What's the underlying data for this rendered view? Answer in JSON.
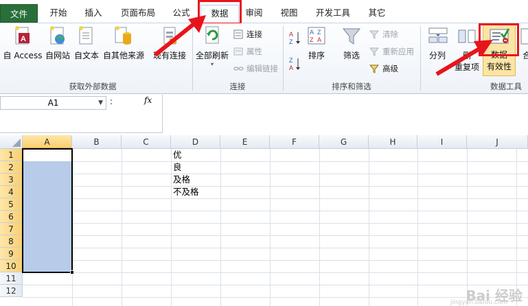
{
  "tabs": [
    {
      "label": "文件"
    },
    {
      "label": "开始"
    },
    {
      "label": "插入"
    },
    {
      "label": "页面布局"
    },
    {
      "label": "公式"
    },
    {
      "label": "数据"
    },
    {
      "label": "审阅"
    },
    {
      "label": "视图"
    },
    {
      "label": "开发工具"
    },
    {
      "label": "其它"
    }
  ],
  "ribbon": {
    "external_data": {
      "label": "获取外部数据",
      "access": "自 Access",
      "web": "自网站",
      "text": "自文本",
      "other": "自其他来源",
      "existing": "现有连接"
    },
    "connections": {
      "label": "连接",
      "refresh_all": "全部刷新",
      "connections": "连接",
      "properties": "属性",
      "edit_links": "编辑链接"
    },
    "sort_filter": {
      "label": "排序和筛选",
      "sort": "排序",
      "filter": "筛选",
      "clear": "清除",
      "reapply": "重新应用",
      "advanced": "高级"
    },
    "data_tools": {
      "label": "数据工具",
      "text_to_columns": "分列",
      "remove_dup_top": "删",
      "remove_dup_bottom": "重复项",
      "validation_top": "数据",
      "validation_bottom": "有效性",
      "consolidate": "合"
    }
  },
  "formula_bar": {
    "name_box": "A1",
    "fx": "fx",
    "value": ""
  },
  "sheet": {
    "columns": [
      "A",
      "B",
      "C",
      "D",
      "E",
      "F",
      "G",
      "H",
      "I",
      "J"
    ],
    "rows": [
      "1",
      "2",
      "3",
      "4",
      "5",
      "6",
      "7",
      "8",
      "9",
      "10",
      "11",
      "12"
    ],
    "cells": {
      "D1": "优",
      "D2": "良",
      "D3": "及格",
      "D4": "不及格"
    },
    "selection": "A1:A10"
  },
  "watermark": {
    "main": "Bai 经验",
    "sub": "jingyan.baidu.com"
  },
  "colors": {
    "file_tab": "#2a6f3a",
    "highlight": "#e8141b",
    "selection_fill": "#b8cbe9"
  }
}
